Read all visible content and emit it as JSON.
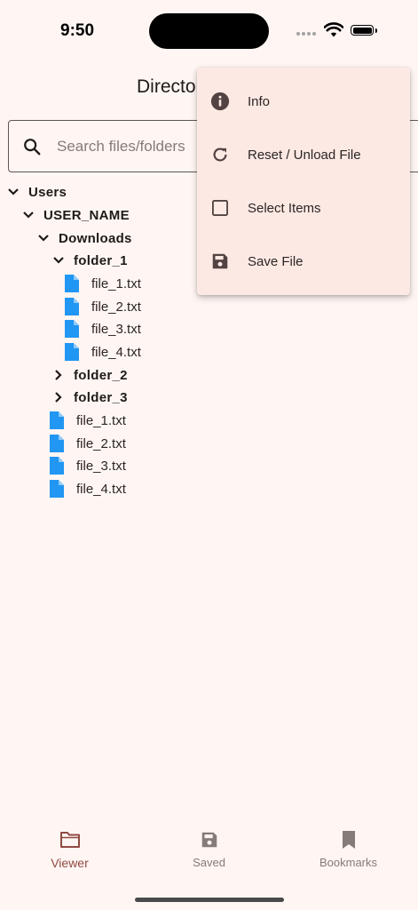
{
  "status": {
    "time": "9:50"
  },
  "header": {
    "title": "Directory"
  },
  "search": {
    "placeholder": "Search files/folders"
  },
  "tree": {
    "users": "Users",
    "user_name": "USER_NAME",
    "downloads": "Downloads",
    "folder_1": "folder_1",
    "folder_1_files": [
      "file_1.txt",
      "file_2.txt",
      "file_3.txt",
      "file_4.txt"
    ],
    "folder_2": "folder_2",
    "folder_3": "folder_3",
    "downloads_files": [
      "file_1.txt",
      "file_2.txt",
      "file_3.txt",
      "file_4.txt"
    ]
  },
  "menu": {
    "items": [
      {
        "label": "Info",
        "icon": "info-icon"
      },
      {
        "label": "Reset / Unload File",
        "icon": "refresh-icon"
      },
      {
        "label": "Select Items",
        "icon": "checkbox-icon"
      },
      {
        "label": "Save File",
        "icon": "save-icon"
      }
    ]
  },
  "nav": {
    "items": [
      {
        "label": "Viewer",
        "icon": "folder-icon",
        "active": true
      },
      {
        "label": "Saved",
        "icon": "save-icon",
        "active": false
      },
      {
        "label": "Bookmarks",
        "icon": "bookmark-icon",
        "active": false
      }
    ]
  },
  "colors": {
    "background": "#FFF6F3",
    "menu_background": "#FDE9E4",
    "file_icon": "#2196F3",
    "active_nav": "#904A42",
    "inactive_nav": "#857B78"
  }
}
